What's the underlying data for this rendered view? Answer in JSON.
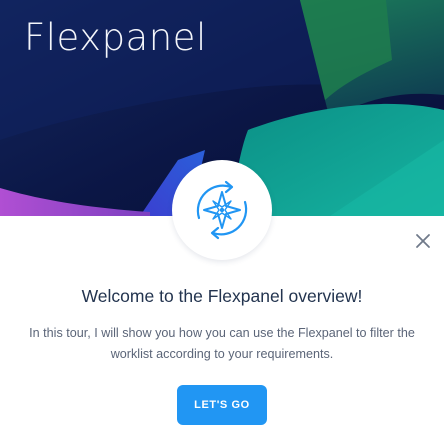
{
  "hero": {
    "title": "Flexpanel"
  },
  "badge": {
    "icon": "compass-refresh-icon"
  },
  "close": {
    "icon": "close-icon"
  },
  "content": {
    "headline": "Welcome to the Flexpanel overview!",
    "body": "In this tour, I will show you how you can use the Flexpanel to filter the worklist according to your requirements."
  },
  "actions": {
    "primary_label": "LET'S GO"
  },
  "colors": {
    "accent": "#2196f3",
    "headline_text": "#23344f",
    "body_text": "#5b6578",
    "hero_dark": "#0b1440",
    "hero_teal": "#0fa59a",
    "hero_magenta": "#a548c8"
  }
}
